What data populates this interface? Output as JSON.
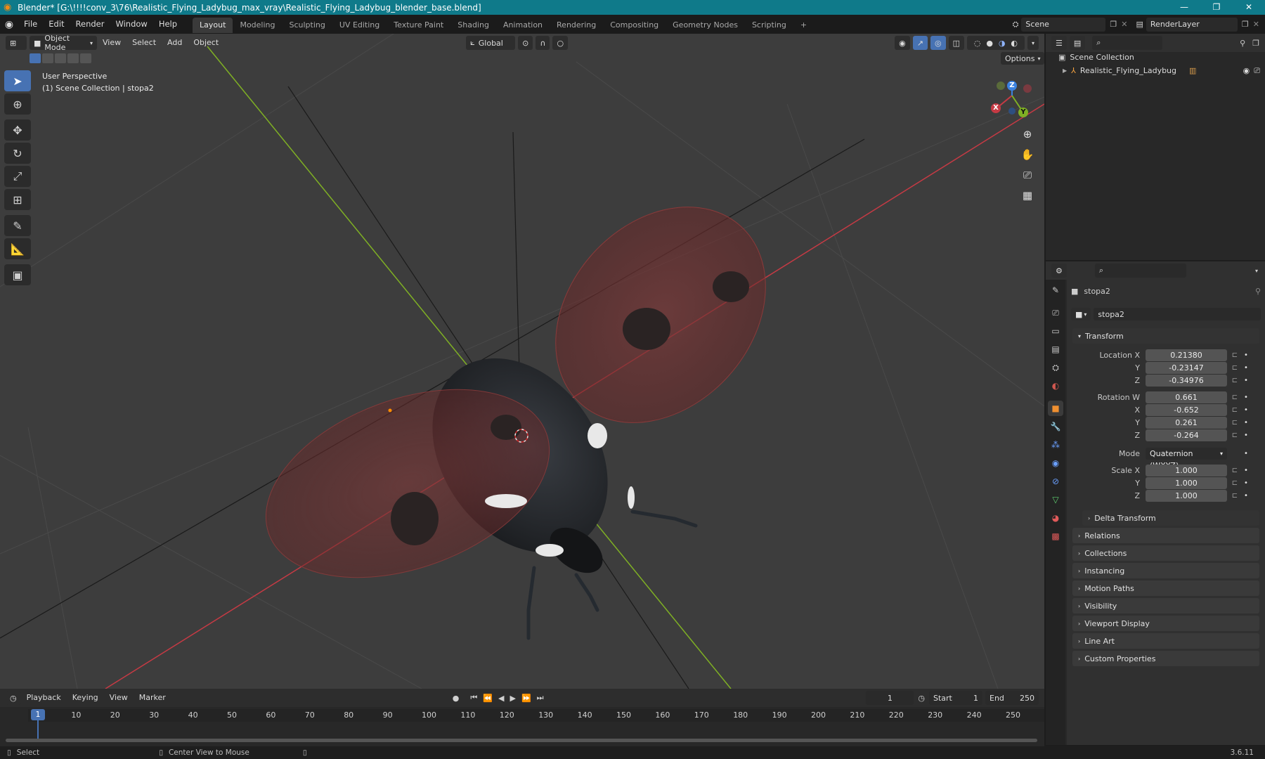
{
  "window": {
    "title": "Blender* [G:\\!!!!conv_3\\76\\Realistic_Flying_Ladybug_max_vray\\Realistic_Flying_Ladybug_blender_base.blend]",
    "controls": [
      "—",
      "❐",
      "✕"
    ]
  },
  "topbar": {
    "menus": [
      "File",
      "Edit",
      "Render",
      "Window",
      "Help"
    ],
    "workspaces": [
      "Layout",
      "Modeling",
      "Sculpting",
      "UV Editing",
      "Texture Paint",
      "Shading",
      "Animation",
      "Rendering",
      "Compositing",
      "Geometry Nodes",
      "Scripting"
    ],
    "active_workspace": "Layout",
    "add_workspace": "+",
    "scene": "Scene",
    "view_layer": "RenderLayer"
  },
  "viewport": {
    "mode": "Object Mode",
    "menus": [
      "View",
      "Select",
      "Add",
      "Object"
    ],
    "orientation": "Global",
    "options_label": "Options",
    "info_line1": "User Perspective",
    "info_line2": "(1) Scene Collection | stopa2",
    "gizmo": {
      "x": "X",
      "y": "Y",
      "z": "Z"
    }
  },
  "outliner": {
    "root": "Scene Collection",
    "items": [
      {
        "name": "Realistic_Flying_Ladybug"
      }
    ]
  },
  "properties": {
    "object_name": "stopa2",
    "data_name": "stopa2",
    "transform_title": "Transform",
    "location": {
      "label": "Location X",
      "x": "0.21380",
      "y": "-0.23147",
      "z": "-0.34976"
    },
    "rotation": {
      "label": "Rotation W",
      "w": "0.661",
      "x": "-0.652",
      "y": "0.261",
      "z": "-0.264"
    },
    "mode": {
      "label": "Mode",
      "value": "Quaternion (WXYZ)"
    },
    "scale": {
      "label": "Scale X",
      "x": "1.000",
      "y": "1.000",
      "z": "1.000"
    },
    "axis_labels": {
      "y": "Y",
      "z": "Z",
      "x": "X"
    },
    "delta_transform": "Delta Transform",
    "panels": [
      "Relations",
      "Collections",
      "Instancing",
      "Motion Paths",
      "Visibility",
      "Viewport Display",
      "Line Art",
      "Custom Properties"
    ]
  },
  "timeline": {
    "menus": [
      "Playback",
      "Keying",
      "View",
      "Marker"
    ],
    "current_frame": "1",
    "start_label": "Start",
    "start": "1",
    "end_label": "End",
    "end": "250",
    "ticks": [
      "1",
      "10",
      "20",
      "30",
      "40",
      "50",
      "60",
      "70",
      "80",
      "90",
      "100",
      "110",
      "120",
      "130",
      "140",
      "150",
      "160",
      "170",
      "180",
      "190",
      "200",
      "210",
      "220",
      "230",
      "240",
      "250"
    ]
  },
  "statusbar": {
    "select": "Select",
    "center": "Center View to Mouse",
    "version": "3.6.11"
  },
  "colors": {
    "titlebar": "#0f7a8a",
    "accent": "#4772b3",
    "x_axis": "#c63a44",
    "y_axis": "#7fb024",
    "z_axis": "#3b82e0"
  }
}
